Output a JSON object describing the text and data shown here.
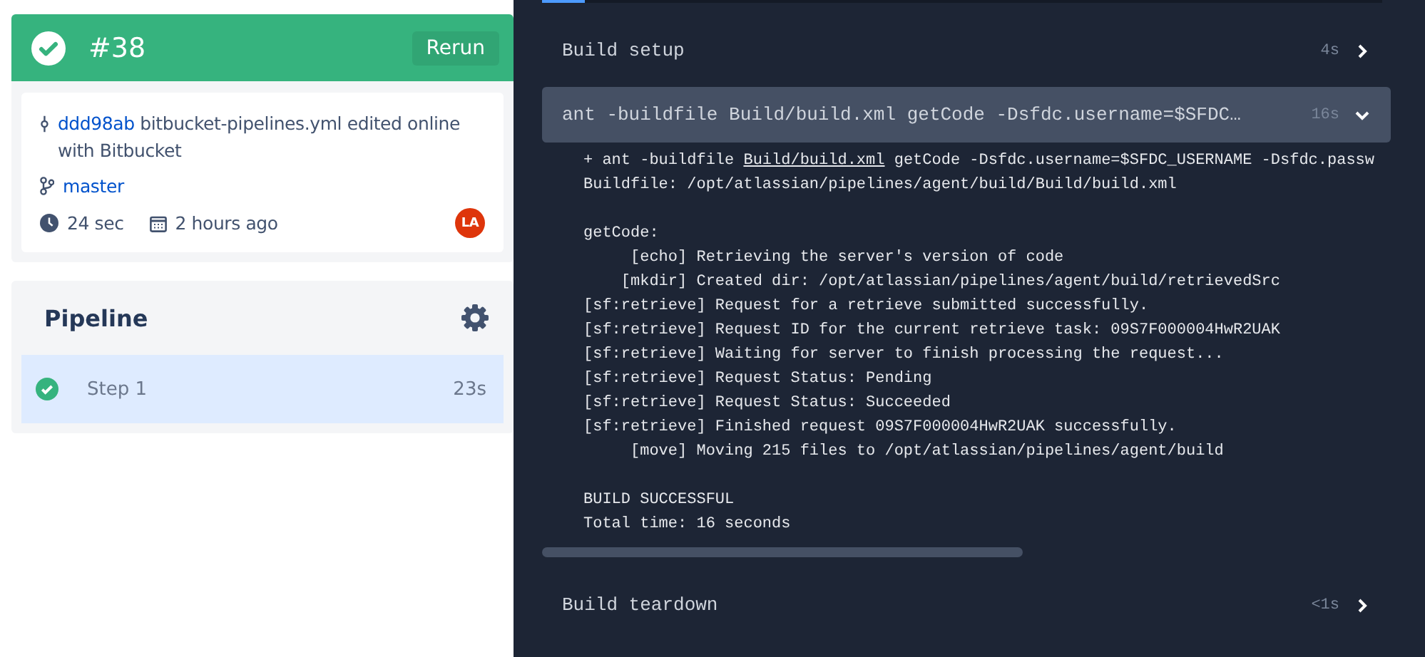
{
  "build": {
    "number": "#38",
    "passed": true,
    "rerun": "Rerun"
  },
  "commit": {
    "hash": "ddd98ab",
    "message": "bitbucket-pipelines.yml edited online with Bitbucket",
    "branch": "master",
    "duration": "24 sec",
    "time": "2 hours ago",
    "avatar": "LA"
  },
  "pipeline": {
    "title": "Pipeline",
    "steps": [
      {
        "name": "Step 1",
        "duration": "23s",
        "passed": true,
        "selected": true
      }
    ]
  },
  "log": {
    "sections": [
      {
        "title": "Build setup",
        "duration": "4s",
        "expanded": false
      },
      {
        "title": "ant -buildfile Build/build.xml getCode -Dsfdc.username=$SFDC…",
        "duration": "16s",
        "expanded": true,
        "blocks": [
          [
            {
              "text": "+ ant -buildfile ",
              "link": "Build/build.xml",
              "after": " getCode -Dsfdc.username=$SFDC_USERNAME -Dsfdc.passw"
            },
            {
              "text": "Buildfile: /opt/atlassian/pipelines/agent/build/Build/build.xml"
            }
          ],
          [
            {
              "text": "getCode:"
            },
            {
              "text": "     [echo] Retrieving the server's version of code"
            },
            {
              "text": "    [mkdir] Created dir: /opt/atlassian/pipelines/agent/build/retrievedSrc"
            },
            {
              "text": "[sf:retrieve] Request for a retrieve submitted successfully."
            },
            {
              "text": "[sf:retrieve] Request ID for the current retrieve task: 09S7F000004HwR2UAK"
            },
            {
              "text": "[sf:retrieve] Waiting for server to finish processing the request..."
            },
            {
              "text": "[sf:retrieve] Request Status: Pending"
            },
            {
              "text": "[sf:retrieve] Request Status: Succeeded"
            },
            {
              "text": "[sf:retrieve] Finished request 09S7F000004HwR2UAK successfully."
            },
            {
              "text": "     [move] Moving 215 files to /opt/atlassian/pipelines/agent/build"
            }
          ],
          [
            {
              "text": "BUILD SUCCESSFUL"
            },
            {
              "text": "Total time: 16 seconds"
            }
          ]
        ]
      },
      {
        "title": "Build teardown",
        "duration": "<1s",
        "expanded": false
      }
    ]
  }
}
